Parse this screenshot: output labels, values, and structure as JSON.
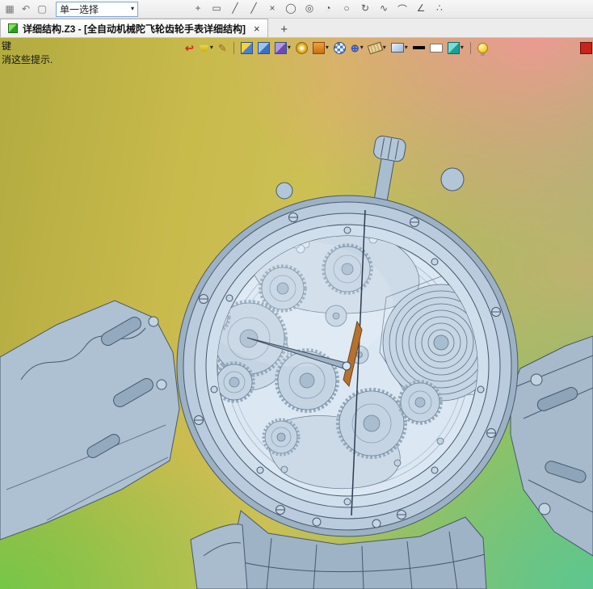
{
  "topbar": {
    "left_icons": [
      "▦",
      "↶",
      "▢"
    ],
    "selection_mode": "单一选择",
    "tools": [
      "+",
      "▭",
      "╱",
      "╱",
      "×",
      "◯",
      "◎",
      "◔",
      "○",
      "↻",
      "∿",
      "⌒",
      "∠",
      "∴"
    ]
  },
  "icons": {
    "caret": "▾"
  },
  "tabbar": {
    "active_title": "详细结构.Z3 - [全自动机械陀飞轮齿轮手表详细结构]",
    "close_glyph": "×",
    "new_tab_glyph": "+"
  },
  "viewport": {
    "hint_line1": "键",
    "hint_line2": "消这些提示."
  },
  "colors": {
    "viewport_top_left": "#b2ab40",
    "viewport_top_right": "#f09894",
    "viewport_bottom_left": "#6ec948",
    "viewport_bottom_right": "#58c696",
    "model_fill": "#c6d6e6",
    "model_outline": "#47586c",
    "red_button": "#c8241c",
    "bulb_yellow": "#f7c81e",
    "select_border": "#7aa7d8"
  }
}
